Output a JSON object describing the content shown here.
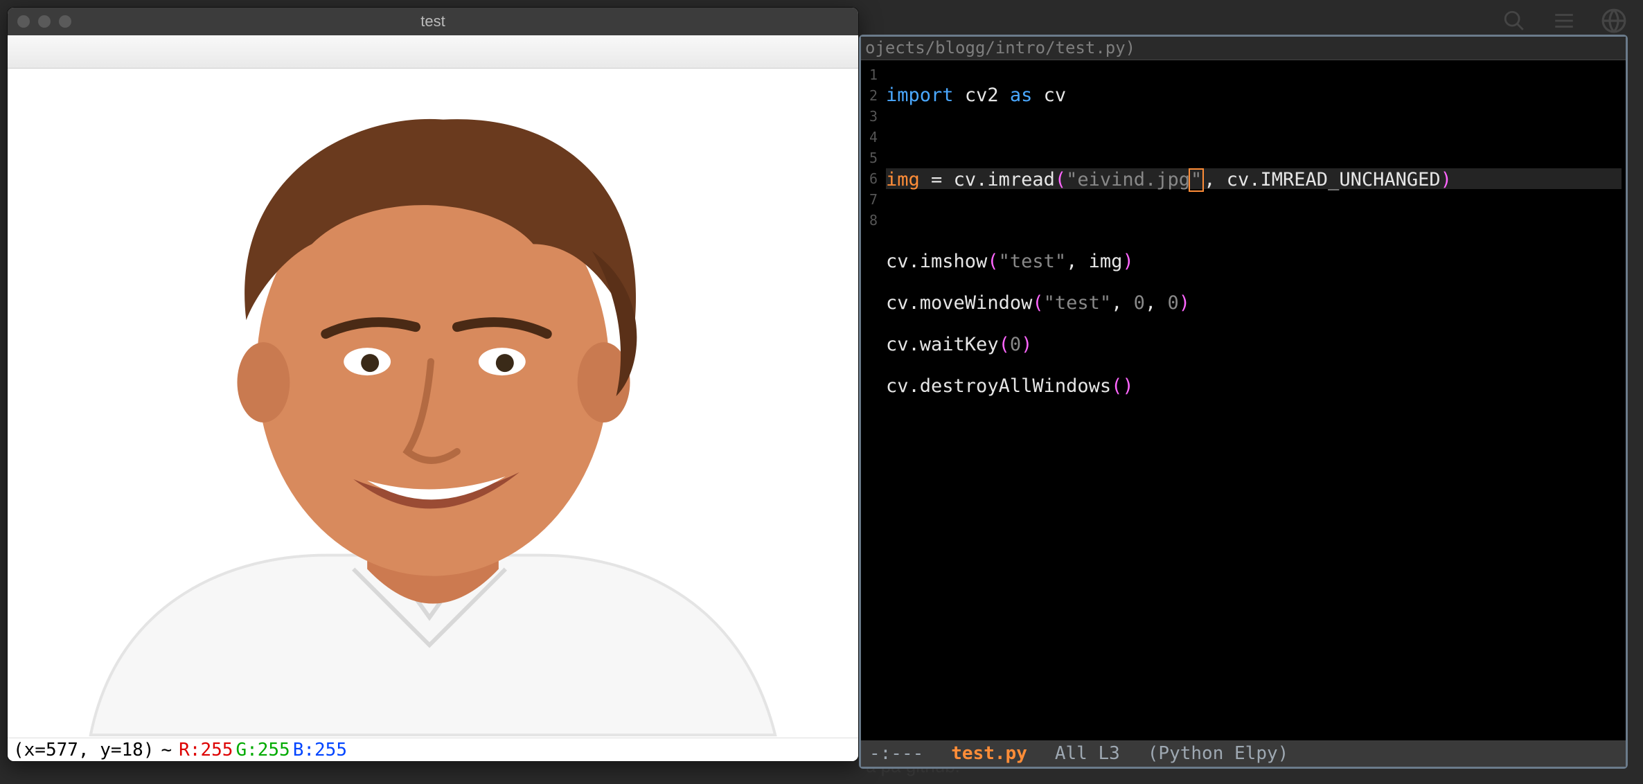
{
  "image_window": {
    "title": "test",
    "statusbar": {
      "coord": "(x=577, y=18)",
      "tilde": "~",
      "r": "R:255",
      "g": "G:255",
      "b": "B:255"
    }
  },
  "editor": {
    "path_suffix": "ojects/blogg/intro/test.py)",
    "gutter": [
      "1",
      "2",
      "3",
      "4",
      "5",
      "6",
      "7",
      "8"
    ],
    "code": {
      "l1": {
        "kw1": "import",
        "m1": "cv2",
        "kw2": "as",
        "m2": "cv"
      },
      "l3": {
        "var": "img",
        "eq": " = ",
        "obj": "cv",
        "fn": "imread",
        "lp": "(",
        "str_open": "\"eivind.jpg",
        "str_close_char": "\"",
        "comma": ", ",
        "obj2": "cv",
        "const": "IMREAD_UNCHANGED",
        "rp": ")"
      },
      "l5": {
        "obj": "cv",
        "fn": "imshow",
        "lp": "(",
        "str": "\"test\"",
        "comma": ", ",
        "arg": "img",
        "rp": ")"
      },
      "l6": {
        "obj": "cv",
        "fn": "moveWindow",
        "lp": "(",
        "str": "\"test\"",
        "comma": ", ",
        "n1": "0",
        "comma2": ", ",
        "n2": "0",
        "rp": ")"
      },
      "l7": {
        "obj": "cv",
        "fn": "waitKey",
        "lp": "(",
        "n": "0",
        "rp": ")"
      },
      "l8": {
        "obj": "cv",
        "fn": "destroyAllWindows",
        "lp": "(",
        "rp": ")"
      }
    },
    "modeline": {
      "left": "-:---",
      "file": "test.py",
      "pos": "All L3",
      "mode": "(Python Elpy)"
    }
  },
  "background": {
    "bottom_text": "a pa gitnub."
  }
}
